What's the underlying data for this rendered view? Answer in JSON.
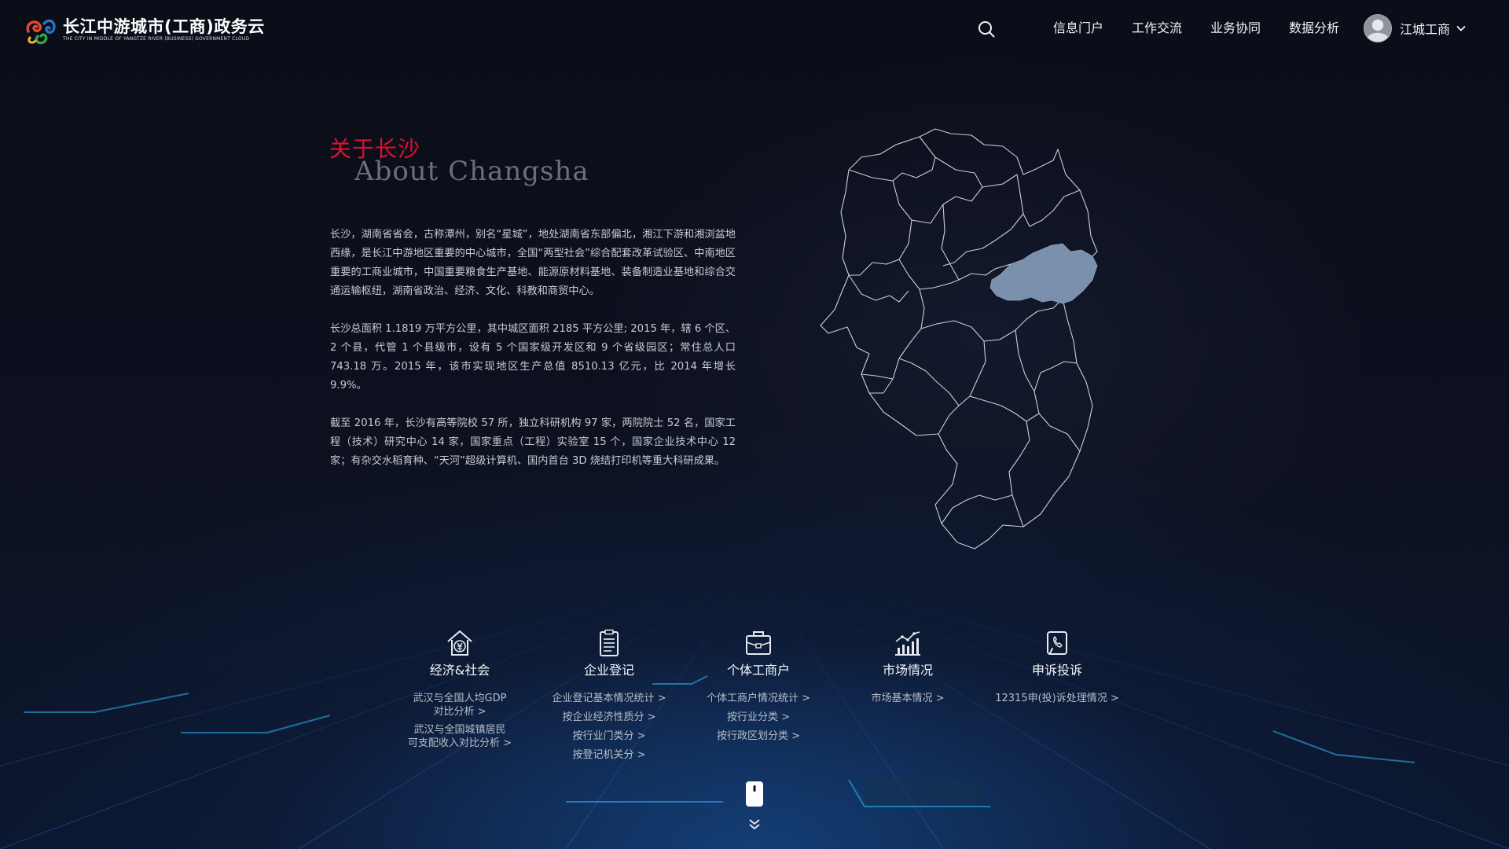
{
  "header": {
    "logo_cn": "长江中游城市(工商)政务云",
    "logo_en": "THE CITY IN MIDDLE OF YANGTZE RIVER (BUSINESS) GOVERNMENT CLOUD",
    "search_icon": "search-icon",
    "nav": [
      "信息门户",
      "工作交流",
      "业务协同",
      "数据分析"
    ],
    "user_name": "江城工商"
  },
  "about": {
    "title_cn": "关于长沙",
    "title_en": "About Changsha",
    "paragraphs": [
      "长沙，湖南省省会，古称潭州，别名“星城”，地处湖南省东部偏北，湘江下游和湘浏盆地西缘，是长江中游地区重要的中心城市，全国“两型社会”综合配套改革试验区、中南地区重要的工商业城市，中国重要粮食生产基地、能源原材料基地、装备制造业基地和综合交通运输枢纽，湖南省政治、经济、文化、科教和商贸中心。",
      "长沙总面积 1.1819 万平方公里，其中城区面积 2185 平方公里; 2015 年，辖 6 个区、2 个县，代管 1 个县级市，设有 5 个国家级开发区和 9 个省级园区；常住总人口 743.18 万。2015 年，该市实现地区生产总值 8510.13 亿元，比 2014 年增长 9.9%。",
      "截至 2016 年，长沙有高等院校 57 所，独立科研机构 97 家，两院院士 52 名，国家工程（技术）研究中心 14 家，国家重点（工程）实验室 15 个，国家企业技术中心 12 家；有杂交水稻育种、“天河”超级计算机、国内首台 3D 烧结打印机等重大科研成果。"
    ]
  },
  "map": {
    "highlight_color": "#7b90ad",
    "outline_color": "#c9cfda"
  },
  "categories": [
    {
      "icon": "house-yuan-icon",
      "title": "经济&社会",
      "links": [
        "武汉与全国人均GDP\n对比分析 >",
        "武汉与全国城镇居民\n可支配收入对比分析 >"
      ]
    },
    {
      "icon": "clipboard-icon",
      "title": "企业登记",
      "links": [
        "企业登记基本情况统计 >",
        "按企业经济性质分 >",
        "按行业门类分 >",
        "按登记机关分 >"
      ]
    },
    {
      "icon": "briefcase-icon",
      "title": "个体工商户",
      "links": [
        "个体工商户情况统计 >",
        "按行业分类 >",
        "按行政区划分类 >"
      ]
    },
    {
      "icon": "bar-chart-icon",
      "title": "市场情况",
      "links": [
        "市场基本情况 >"
      ]
    },
    {
      "icon": "phone-complaint-icon",
      "title": "申诉投诉",
      "links": [
        "12315申(投)诉处理情况 >"
      ]
    }
  ],
  "colors": {
    "accent_red": "#e0102f",
    "background": "#0c0f1a"
  }
}
